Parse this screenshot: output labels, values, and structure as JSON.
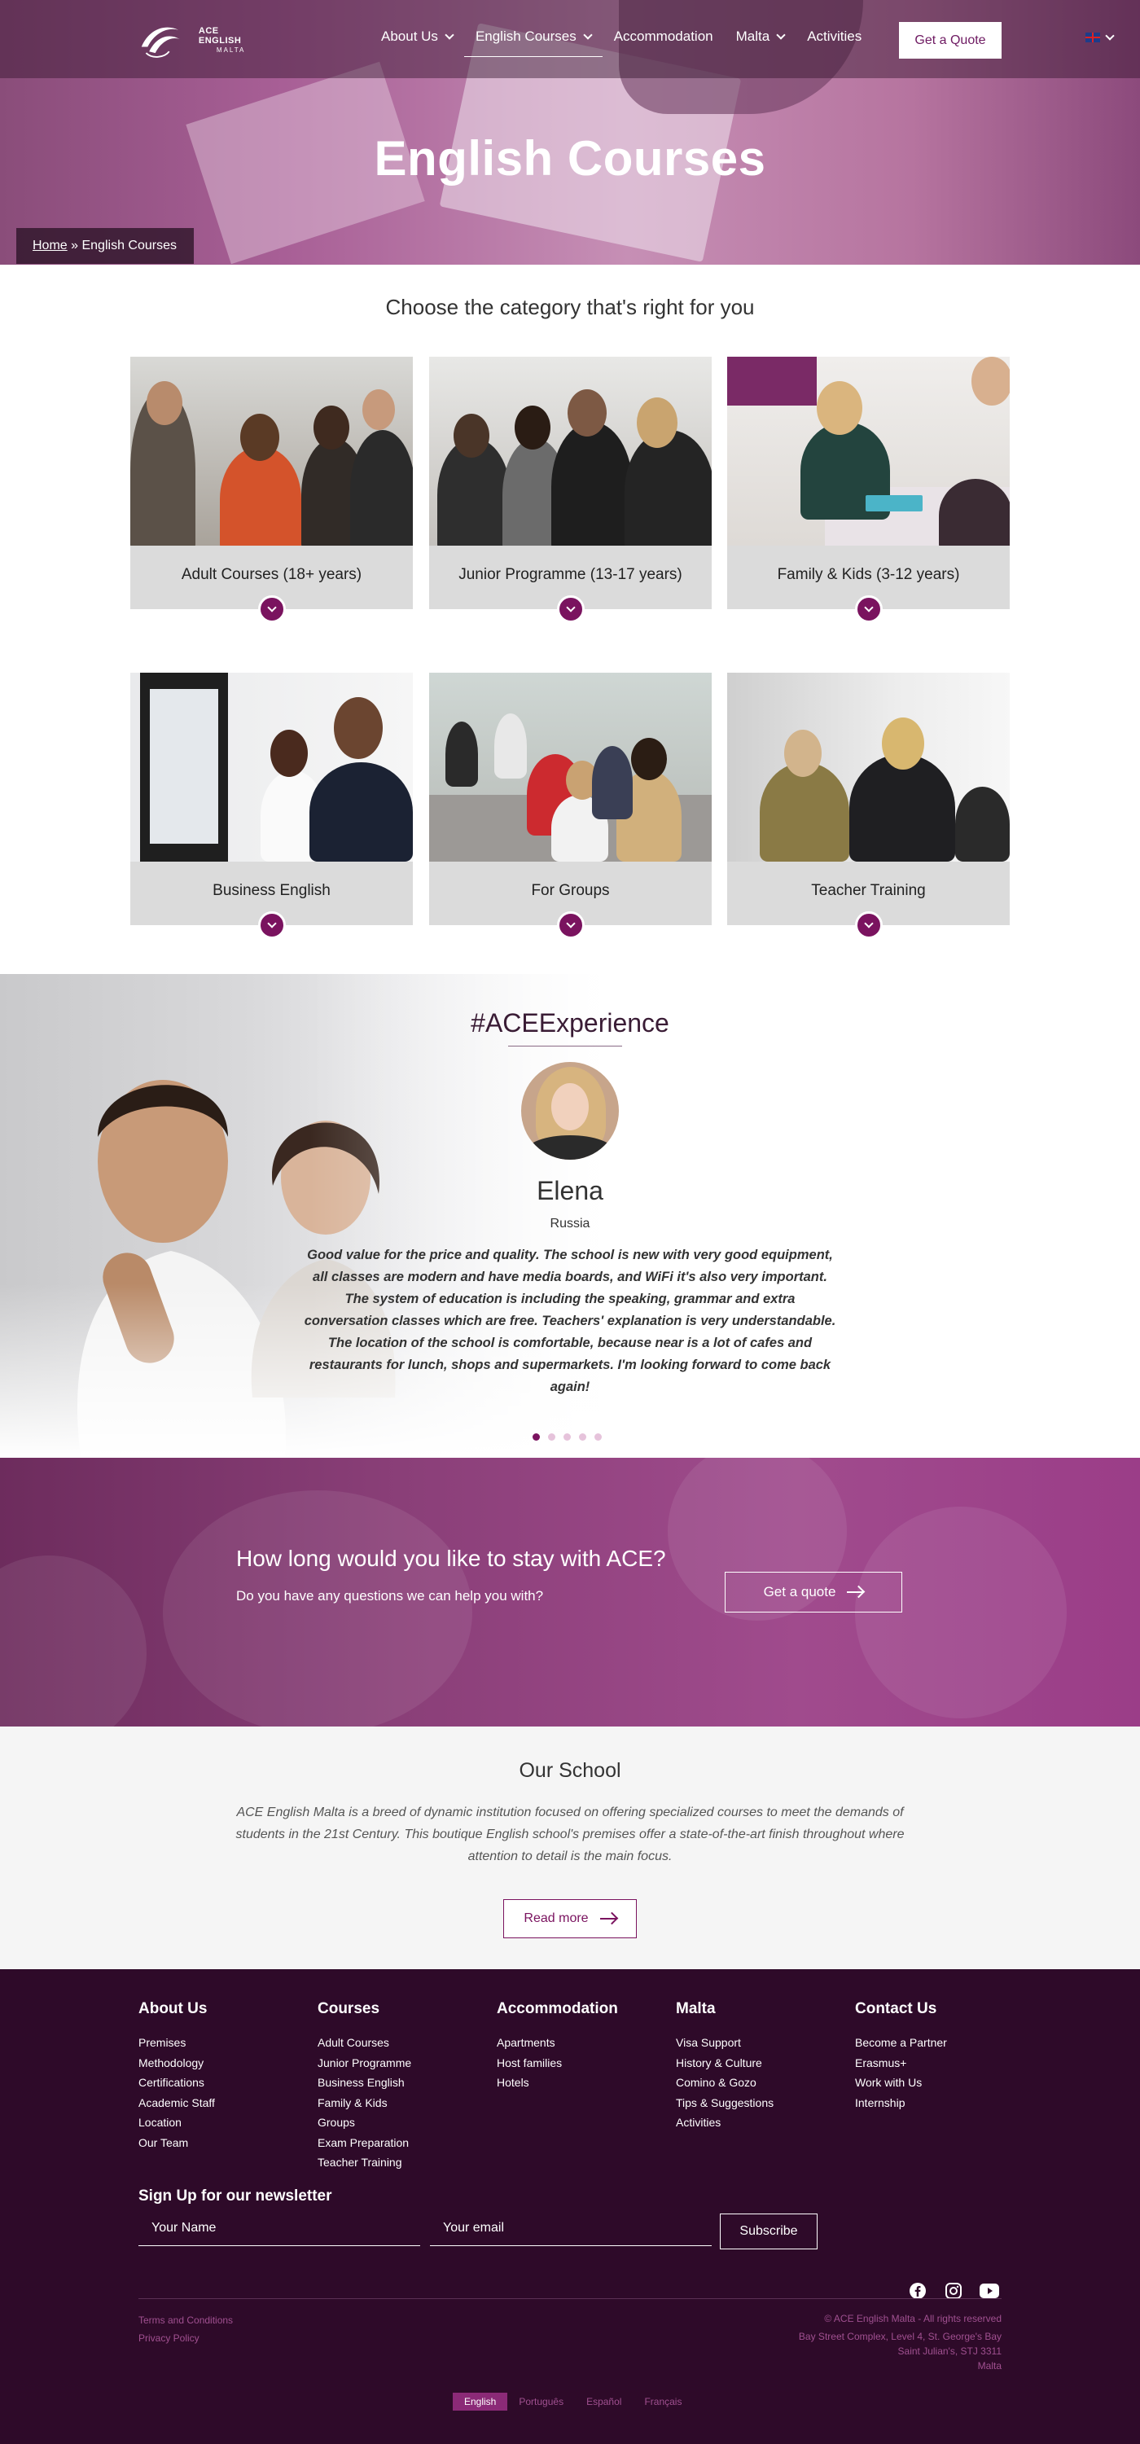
{
  "header": {
    "logo_text": "ACE ENGLISH",
    "logo_sub": "MALTA",
    "menu": [
      {
        "label": "About Us",
        "has_dropdown": true
      },
      {
        "label": "English Courses",
        "has_dropdown": true,
        "active": true
      },
      {
        "label": "Accommodation",
        "has_dropdown": false
      },
      {
        "label": "Malta",
        "has_dropdown": true
      },
      {
        "label": "Activities",
        "has_dropdown": false
      }
    ],
    "quote_button": "Get a Quote",
    "language_icon": "uk-flag-icon"
  },
  "hero": {
    "title": "English Courses",
    "breadcrumb_home": "Home",
    "breadcrumb_sep": " » ",
    "breadcrumb_current": "English Courses"
  },
  "categories": {
    "heading": "Choose the category that's right for you",
    "items": [
      {
        "label": "Adult Courses (18+ years)"
      },
      {
        "label": "Junior Programme (13-17 years)"
      },
      {
        "label": "Family & Kids (3-12 years)"
      },
      {
        "label": "Business English"
      },
      {
        "label": "For Groups"
      },
      {
        "label": "Teacher Training"
      }
    ]
  },
  "testimonial": {
    "heading": "#ACEExperience",
    "name": "Elena",
    "country": "Russia",
    "quote": "Good value for the price and quality. The school is new with very good equipment, all classes are modern and have media boards, and WiFi it's also very important. The system of education is including the speaking, grammar and extra conversation classes which are free. Teachers' explanation is very understandable. The location of the school is comfortable, because near is a lot of cafes and restaurants for lunch, shops and supermarkets. I'm looking forward to come back again!",
    "slide_count": 5,
    "active_slide": 1
  },
  "cta": {
    "heading": "How long would you like to stay with ACE?",
    "subtext": "Do you have any questions we can help you with?",
    "button": "Get a quote"
  },
  "school": {
    "heading": "Our School",
    "text": "ACE English Malta is a breed of dynamic institution focused on offering specialized courses to meet the demands of students in the 21st Century. This boutique English school's premises offer a state-of-the-art finish throughout where attention to detail is the main focus.",
    "button": "Read more"
  },
  "footer": {
    "columns": [
      {
        "title": "About Us",
        "links": [
          "Premises",
          "Methodology",
          "Certifications",
          "Academic Staff",
          "Location",
          "Our Team"
        ]
      },
      {
        "title": "Courses",
        "links": [
          "Adult Courses",
          "Junior Programme",
          "Business English",
          "Family & Kids",
          "Groups",
          "Exam Preparation",
          "Teacher Training"
        ]
      },
      {
        "title": "Accommodation",
        "links": [
          "Apartments",
          "Host families",
          "Hotels"
        ]
      },
      {
        "title": "Malta",
        "links": [
          "Visa Support",
          "History & Culture",
          "Comino & Gozo",
          "Tips & Suggestions",
          "Activities"
        ]
      },
      {
        "title": "Contact Us",
        "links": [
          "Become a Partner",
          "Erasmus+",
          "Work with Us",
          "Internship"
        ]
      }
    ],
    "newsletter": {
      "title": "Sign Up for our newsletter",
      "name_placeholder": "Your Name",
      "email_placeholder": "Your email",
      "button": "Subscribe"
    },
    "social": [
      "facebook-icon",
      "instagram-icon",
      "youtube-icon"
    ],
    "legal": [
      "Terms and Conditions",
      "Privacy Policy"
    ],
    "copyright": "© ACE English Malta - All rights reserved",
    "address": [
      "Bay Street Complex, Level 4, St. George's Bay",
      "Saint Julian's, STJ 3311",
      "Malta"
    ],
    "languages": [
      {
        "label": "English",
        "active": true
      },
      {
        "label": "Português",
        "active": false
      },
      {
        "label": "Español",
        "active": false
      },
      {
        "label": "Français",
        "active": false
      }
    ]
  },
  "colors": {
    "brand": "#7a135f",
    "footer_bg": "#2e0a29",
    "caption_bg": "#dbdbdb"
  }
}
